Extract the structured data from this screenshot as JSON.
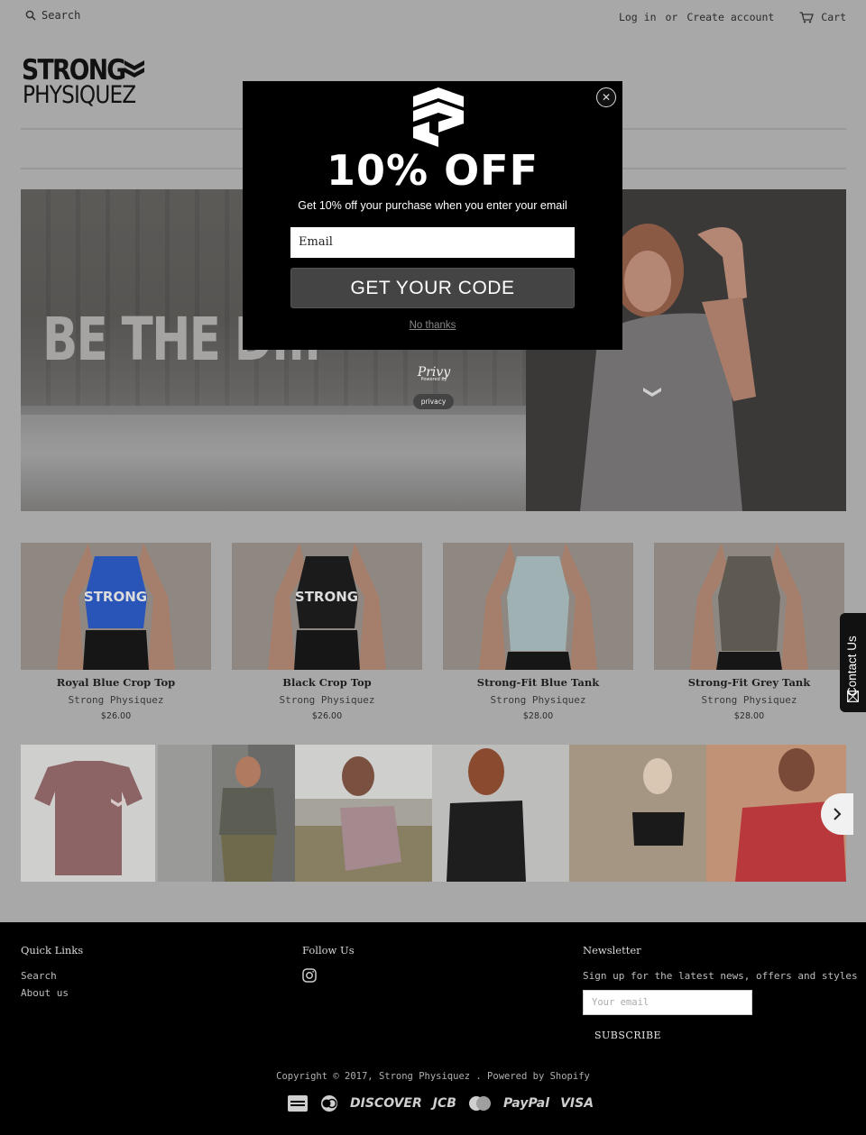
{
  "header": {
    "search_label": "Search",
    "login_label": "Log in",
    "or_label": "or",
    "create_account_label": "Create account",
    "cart_label": "Cart"
  },
  "logo": {
    "line1": "STRONG",
    "line2": "PHYSIQUEZ"
  },
  "hero": {
    "text": "BE THE D..."
  },
  "popup": {
    "headline": "10% OFF",
    "subtext": "Get 10% off your purchase when you enter your email",
    "email_placeholder": "Email",
    "cta_label": "GET YOUR CODE",
    "dismiss_label": "No thanks",
    "close_symbol": "✕"
  },
  "privy": {
    "brand": "Privy",
    "powered": "Powered by",
    "privacy_label": "privacy"
  },
  "products": [
    {
      "name": "Royal Blue Crop Top",
      "vendor": "Strong Physiquez",
      "price": "$26.00",
      "color": "#2a55b8",
      "print": "STRONG"
    },
    {
      "name": "Black Crop Top",
      "vendor": "Strong Physiquez",
      "price": "$26.00",
      "color": "#1b1b1b",
      "print": "STRONG"
    },
    {
      "name": "Strong-Fit Blue Tank",
      "vendor": "Strong Physiquez",
      "price": "$28.00",
      "color": "#9fb1b2",
      "print": ""
    },
    {
      "name": "Strong-Fit Grey Tank",
      "vendor": "Strong Physiquez",
      "price": "$28.00",
      "color": "#5e5a52",
      "print": ""
    }
  ],
  "contact_tab": {
    "label": "Contact Us"
  },
  "footer": {
    "quick_links_heading": "Quick Links",
    "quick_links": [
      "Search",
      "About us"
    ],
    "follow_heading": "Follow Us",
    "newsletter_heading": "Newsletter",
    "newsletter_text": "Sign up for the latest news, offers and styles",
    "newsletter_placeholder": "Your email",
    "subscribe_label": "SUBSCRIBE",
    "copyright": "Copyright © 2017, Strong Physiquez . Powered by Shopify",
    "payment_methods": [
      "DISCOVER",
      "JCB",
      "PayPal",
      "VISA"
    ]
  },
  "colors": {
    "overlay_bg": "#a8a8a8",
    "popup_bg": "#000000",
    "cta_bg": "#444444",
    "footer_bg": "#000000"
  }
}
